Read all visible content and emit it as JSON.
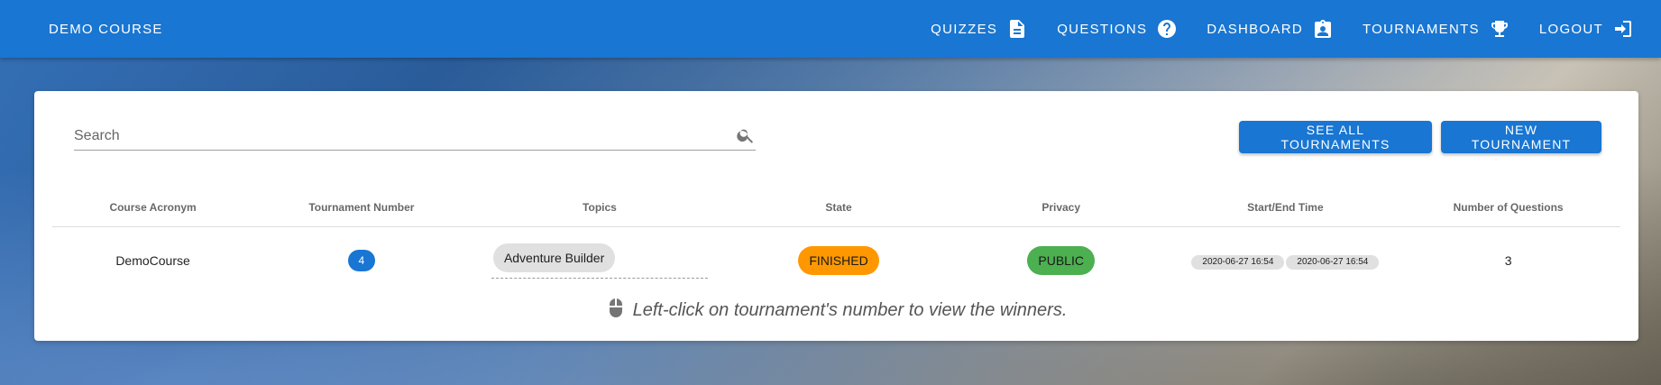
{
  "topbar": {
    "title": "DEMO COURSE",
    "bg_color": "#1976d2",
    "nav": [
      {
        "label": "QUIZZES",
        "icon": "file-document-icon"
      },
      {
        "label": "QUESTIONS",
        "icon": "help-circle-icon"
      },
      {
        "label": "DASHBOARD",
        "icon": "account-box-icon"
      },
      {
        "label": "TOURNAMENTS",
        "icon": "trophy-icon"
      },
      {
        "label": "LOGOUT",
        "icon": "logout-icon"
      }
    ]
  },
  "search": {
    "placeholder": "Search",
    "value": ""
  },
  "buttons": {
    "see_all": "SEE ALL TOURNAMENTS",
    "new_tournament": "NEW TOURNAMENT"
  },
  "table": {
    "headers": [
      "Course Acronym",
      "Tournament Number",
      "Topics",
      "State",
      "Privacy",
      "Start/End Time",
      "Number of Questions"
    ],
    "rows": [
      {
        "course_acronym": "DemoCourse",
        "tournament_number": "4",
        "topics": [
          "Adventure Builder"
        ],
        "state": {
          "label": "FINISHED",
          "color": "#ff9800"
        },
        "privacy": {
          "label": "PUBLIC",
          "color": "#4caf50"
        },
        "start_time": "2020-06-27 16:54",
        "end_time": "2020-06-27 16:54",
        "num_questions": "3"
      }
    ]
  },
  "hint": {
    "text": "Left-click on tournament's number to view the winners.",
    "icon": "mouse-icon"
  }
}
